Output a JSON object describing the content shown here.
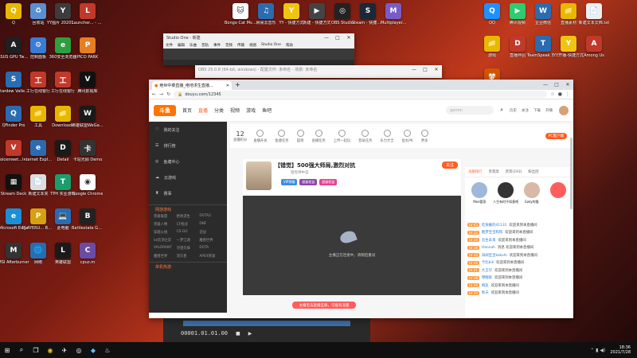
{
  "desktop_left": [
    {
      "label": "Q",
      "color": "#e8b800",
      "glyph": "Q"
    },
    {
      "label": "回收站",
      "color": "#5a8fd1",
      "glyph": "♻"
    },
    {
      "label": "YY图片 20201105...",
      "color": "#3c3c3c",
      "glyph": "Y"
    },
    {
      "label": "Launcher... - 快捷方式",
      "color": "#c0392b",
      "glyph": "L"
    },
    {
      "label": "ASUS GPU Tweak II",
      "color": "#202020",
      "glyph": "A"
    },
    {
      "label": "控制面板",
      "color": "#3a7bd5",
      "glyph": "⚙"
    },
    {
      "label": "360安全浏览器",
      "color": "#2e9e3e",
      "glyph": "e"
    },
    {
      "label": "PICO PARK",
      "color": "#e67e22",
      "glyph": "P"
    },
    {
      "label": "Stardew Valley Sa...",
      "color": "#2b6cb0",
      "glyph": "S"
    },
    {
      "label": "工行在线银行",
      "color": "#c0392b",
      "glyph": "工"
    },
    {
      "label": "工行在线银行",
      "color": "#c0392b",
      "glyph": "工"
    },
    {
      "label": "腾讯影视库",
      "color": "#111",
      "glyph": "V"
    },
    {
      "label": "QFinder Pro",
      "color": "#2b6cb0",
      "glyph": "Q"
    },
    {
      "label": "工具",
      "color": "#e8b800",
      "glyph": "📁"
    },
    {
      "label": "Downloads",
      "color": "#e8b800",
      "glyph": "📁"
    },
    {
      "label": "英雄联盟WeGame版",
      "color": "#1a1a1a",
      "glyph": "W"
    },
    {
      "label": "voicemeet... - 快捷方式",
      "color": "#c0392b",
      "glyph": "V"
    },
    {
      "label": "Internet Explorer",
      "color": "#2b6cb0",
      "glyph": "e"
    },
    {
      "label": "Detail",
      "color": "#1a1a1a",
      "glyph": "D"
    },
    {
      "label": "卡站光顾 Demo",
      "color": "#333",
      "glyph": "卡"
    },
    {
      "label": "Stream Deck",
      "color": "#111",
      "glyph": "▦"
    },
    {
      "label": "新建文本夹",
      "color": "#ddd",
      "glyph": "📄"
    },
    {
      "label": "TPH 实业游戏",
      "color": "#1a9e6e",
      "glyph": "T"
    },
    {
      "label": "Google Chrome",
      "color": "#fff",
      "glyph": "◉"
    },
    {
      "label": "Microsoft Edge",
      "color": "#1b8fd6",
      "glyph": "e"
    },
    {
      "label": "PLAYERU... BATTLEGR...",
      "color": "#d7a010",
      "glyph": "P"
    },
    {
      "label": "此电脑",
      "color": "#2b6cb0",
      "glyph": "💻"
    },
    {
      "label": "Battlestate Games L...",
      "color": "#222",
      "glyph": "B"
    },
    {
      "label": "MSI Afterburner",
      "color": "#333",
      "glyph": "M"
    },
    {
      "label": "网络",
      "color": "#2b6cb0",
      "glyph": "🌐"
    },
    {
      "label": "英雄联盟",
      "color": "#1a1a1a",
      "glyph": "L"
    },
    {
      "label": "cpuz.m",
      "color": "#6b4ca5",
      "glyph": "C"
    }
  ],
  "desktop_top": [
    {
      "label": "Bongo Cat Mver.exe",
      "color": "#fff",
      "glyph": "🐱"
    },
    {
      "label": "网易云音乐",
      "color": "#2b6cb0",
      "glyph": "♫"
    },
    {
      "label": "YY - 快捷方式",
      "color": "#f1c40f",
      "glyph": "Y"
    },
    {
      "label": "新建 - 快捷方式",
      "color": "#444",
      "glyph": "▶"
    },
    {
      "label": "OBS Studio",
      "color": "#222",
      "glyph": "◎"
    },
    {
      "label": "Steam - 快捷方式",
      "color": "#1b2838",
      "glyph": "S"
    },
    {
      "label": "Multiplayer...",
      "color": "#7a5cc9",
      "glyph": "M"
    }
  ],
  "desktop_right": [
    {
      "label": "QQ",
      "color": "#1e90ff",
      "glyph": "Q"
    },
    {
      "label": "腾讯视频",
      "color": "#2ecc71",
      "glyph": "▶"
    },
    {
      "label": "企业微信",
      "color": "#2b6cb0",
      "glyph": "W"
    },
    {
      "label": "直播素材",
      "color": "#e8b800",
      "glyph": "📁"
    },
    {
      "label": "新建文本文档.txt",
      "color": "#eee",
      "glyph": "📄"
    },
    {
      "label": "游戏",
      "color": "#e8b800",
      "glyph": "📁"
    },
    {
      "label": "直播伴侣",
      "color": "#c0392b",
      "glyph": "D"
    },
    {
      "label": "TeamSpeak 3 Client",
      "color": "#2b6cb0",
      "glyph": "T"
    },
    {
      "label": "YY开播-快捷方式",
      "color": "#f1c40f",
      "glyph": "Y"
    },
    {
      "label": "Among Us",
      "color": "#c0392b",
      "glyph": "A"
    },
    {
      "label": "梦幻西游",
      "color": "#d35400",
      "glyph": "梦"
    }
  ],
  "studio_one": {
    "title": "Studio One - 新建",
    "menu": [
      "文件",
      "编辑",
      "乐曲",
      "音轨",
      "事件",
      "音频",
      "传输",
      "视图",
      "Studio One",
      "帮助"
    ],
    "timecode": "00001.01.01.00"
  },
  "obs": {
    "title": "OBS 25.0.8 (64-bit, windows) - 配置文件: 未命名 - 场景: 未命名"
  },
  "browser": {
    "tab_title": "绝世中菜直播_绝地求生直播...",
    "url": "douyu.com/12345",
    "logo": "斗鱼",
    "nav": [
      "首页",
      "直播",
      "分类",
      "视频",
      "游戏",
      "鱼吧"
    ],
    "search_placeholder": "genmi",
    "top_icons": [
      "历史",
      "关注",
      "下载",
      "开播"
    ],
    "sidebar": [
      "我的关注",
      "排行榜",
      "鱼塘中心",
      "云游戏",
      "赛事"
    ],
    "sidebar_section": "网游游戏",
    "sidebar_games": [
      "英雄联盟",
      "绝地求生",
      "DOTA2",
      "英雄人物",
      "CF枪战",
      "DNF",
      "穿越火线",
      "CS:GO",
      "逆战",
      "lol云顶之弈",
      "一梦江湖",
      "魔兽世界",
      "VALORANT",
      "守望先锋",
      "DOTA",
      "魔兽世界",
      "消灭星",
      "APEX英雄"
    ],
    "sidebar_section2": "单机热游",
    "stat_count": "12",
    "stat_label": "直播积分",
    "stats": [
      "直播开关",
      "鱼塘任务",
      "超清",
      "直播任务",
      "上传一起玩",
      "登录任务",
      "乐力大全",
      "鱼丸PK",
      "更多"
    ],
    "room_title": "【错觉】500强大师局,激烈对抗",
    "room_meta": "错觉神中菜",
    "room_tags": [
      "VIP荣耀",
      "超级权益",
      "超级权益"
    ],
    "follow_btn": "关注",
    "player_msg": "主播正在连接中，请稍后重试",
    "promo": "主播无法直播互联，可能有流量",
    "chat_tabs": [
      "贡献排行",
      "贵宾席",
      "贵宾(193)",
      "粉丝团"
    ],
    "top_fans": [
      "Moe管家",
      "人生有时不如意吧",
      "Ewly的猫",
      ""
    ],
    "chat": [
      {
        "lv": "LV 65",
        "name": "吃快餐的41131",
        "text": "欢迎来到本直播间"
      },
      {
        "lv": "LV 22",
        "name": "眠梦宝宝和铁",
        "text": "欢迎来到本直播间"
      },
      {
        "lv": "LV 24",
        "name": "吾生未来",
        "text": "欢迎来到本直播间"
      },
      {
        "lv": "LV 18",
        "name": "Hannah",
        "text": "消息 欢迎来到本直播间"
      },
      {
        "lv": "LV 20",
        "name": "海阔宝宝kokuhi",
        "text": "欢迎来到本直播间"
      },
      {
        "lv": "LV 16",
        "name": "卡比bili",
        "text": "欢迎来到本直播间"
      },
      {
        "lv": "LV 21",
        "name": "大王仔",
        "text": "欢迎来到本直播间"
      },
      {
        "lv": "LV 18",
        "name": "锦鲤家",
        "text": "欢迎来到本直播间"
      },
      {
        "lv": "LV 26",
        "name": "网友",
        "text": "欢迎来到本直播间"
      },
      {
        "lv": "LV 20",
        "name": "秋天",
        "text": "欢迎来到本直播间"
      }
    ]
  },
  "taskbar": {
    "time": "18:36",
    "date": "2021/7/28"
  }
}
